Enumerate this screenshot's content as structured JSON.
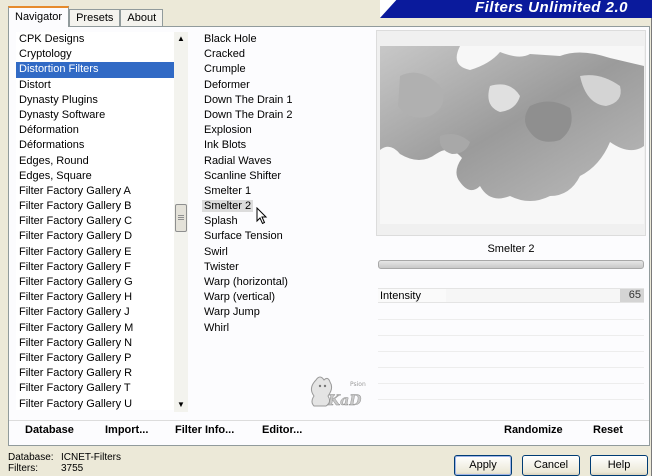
{
  "app": {
    "title": "Filters Unlimited 2.0"
  },
  "tabs": [
    {
      "label": "Navigator",
      "active": true
    },
    {
      "label": "Presets",
      "active": false
    },
    {
      "label": "About",
      "active": false
    }
  ],
  "categories": [
    "CPK Designs",
    "Cryptology",
    "Distortion Filters",
    "Distort",
    "Dynasty Plugins",
    "Dynasty Software",
    "Déformation",
    "Déformations",
    "Edges, Round",
    "Edges, Square",
    "Filter Factory Gallery A",
    "Filter Factory Gallery B",
    "Filter Factory Gallery C",
    "Filter Factory Gallery D",
    "Filter Factory Gallery E",
    "Filter Factory Gallery F",
    "Filter Factory Gallery G",
    "Filter Factory Gallery H",
    "Filter Factory Gallery J",
    "Filter Factory Gallery M",
    "Filter Factory Gallery N",
    "Filter Factory Gallery P",
    "Filter Factory Gallery R",
    "Filter Factory Gallery T",
    "Filter Factory Gallery U"
  ],
  "selected_category": "Distortion Filters",
  "filters": [
    "Black Hole",
    "Cracked",
    "Crumple",
    "Deformer",
    "Down The Drain 1",
    "Down The Drain 2",
    "Explosion",
    "Ink Blots",
    "Radial Waves",
    "Scanline Shifter",
    "Smelter 1",
    "Smelter 2",
    "Splash",
    "Surface Tension",
    "Swirl",
    "Twister",
    "Warp (horizontal)",
    "Warp (vertical)",
    "Warp Jump",
    "Whirl"
  ],
  "selected_filter": "Smelter 2",
  "preview": {
    "filter_name": "Smelter 2"
  },
  "parameters": [
    {
      "label": "Intensity",
      "value": "65",
      "fraction": 0.255
    }
  ],
  "toolbar": {
    "database": "Database",
    "import": "Import...",
    "filter_info": "Filter Info...",
    "editor": "Editor...",
    "randomize": "Randomize",
    "reset": "Reset"
  },
  "status": {
    "database_label": "Database:",
    "database_value": "ICNET-Filters",
    "filters_label": "Filters:",
    "filters_value": "3755"
  },
  "buttons": {
    "apply": "Apply",
    "cancel": "Cancel",
    "help": "Help"
  },
  "colors": {
    "banner": "#0a1a9c",
    "selection": "#316ac5",
    "active_tab_accent": "#e68b2c"
  },
  "watermark": {
    "text": "KaD",
    "small": "Psion"
  }
}
